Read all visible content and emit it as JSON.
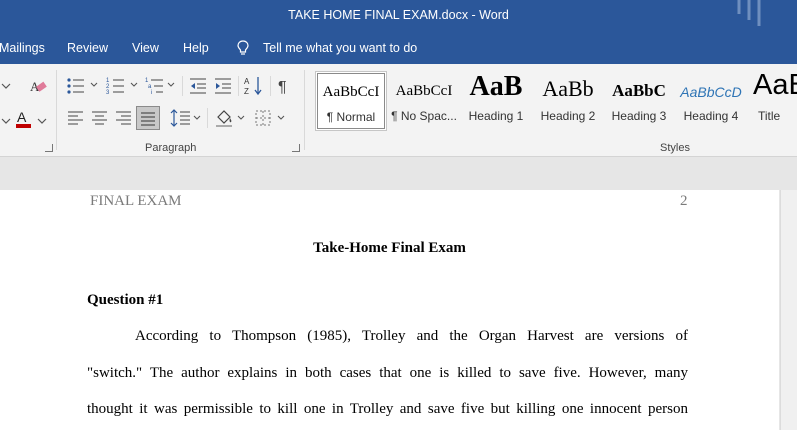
{
  "window": {
    "title": "TAKE HOME FINAL EXAM.docx  -  Word"
  },
  "menu": {
    "mailings": "Mailings",
    "review": "Review",
    "view": "View",
    "help": "Help",
    "tell_me": "Tell me what you want to do"
  },
  "ribbon": {
    "paragraph_label": "Paragraph",
    "styles_label": "Styles",
    "styles": [
      {
        "preview": "AaBbCcI",
        "label": "¶ Normal"
      },
      {
        "preview": "AaBbCcI",
        "label": "¶ No Spac..."
      },
      {
        "preview": "AaB",
        "label": "Heading 1"
      },
      {
        "preview": "AaBb",
        "label": "Heading 2"
      },
      {
        "preview": "AaBbC",
        "label": "Heading 3"
      },
      {
        "preview": "AaBbCcD",
        "label": "Heading 4"
      },
      {
        "preview": "AaB",
        "label": "Title"
      }
    ]
  },
  "document": {
    "header_left": "FINAL EXAM",
    "header_page": "2",
    "title": "Take-Home Final Exam",
    "question_heading": "Question #1",
    "lines": [
      "According to Thompson (1985), Trolley and the Organ Harvest are versions of",
      "\"switch.\" The author explains in both cases that one is killed to save five. However, many",
      "thought it was permissible to kill one in Trolley and save five but killing one innocent person"
    ]
  },
  "colors": {
    "title_bar": "#2b579a",
    "ribbon": "#f3f3f3",
    "font_color_red": "#c00000"
  }
}
